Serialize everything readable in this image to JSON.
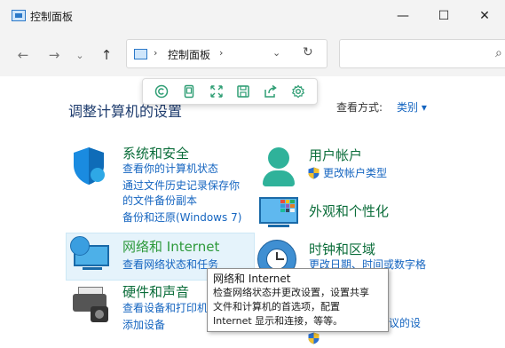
{
  "window": {
    "title": "控制面板",
    "minimize_glyph": "—",
    "maximize_glyph": "☐",
    "close_glyph": "✕"
  },
  "nav": {
    "back_glyph": "←",
    "forward_glyph": "→",
    "recent_glyph": "⌄",
    "up_glyph": "↑",
    "address": {
      "separator": "›",
      "path": "控制面板",
      "dropdown_glyph": "⌄",
      "refresh_glyph": "↻"
    },
    "search": {
      "icon_glyph": "⌕"
    }
  },
  "floating_toolbar": {
    "icons": [
      "copyright-circle-icon",
      "tablet-icon",
      "expand-icon",
      "save-icon",
      "share-icon",
      "settings-icon"
    ]
  },
  "header": {
    "heading": "调整计算机的设置",
    "view_label": "查看方式:",
    "view_value": "类别 ▾"
  },
  "categories": {
    "system_security": {
      "title": "系统和安全",
      "links": [
        "查看你的计算机状态",
        "通过文件历史记录保存你",
        "的文件备份副本",
        "备份和还原(Windows 7)"
      ]
    },
    "network": {
      "title": "网络和 Internet",
      "links": [
        "查看网络状态和任务"
      ]
    },
    "hardware": {
      "title": "硬件和声音",
      "links": [
        "查看设备和打印机",
        "添加设备"
      ]
    },
    "user_accounts": {
      "title": "用户帐户",
      "links": [
        "更改帐户类型"
      ]
    },
    "appearance": {
      "title": "外观和个性化"
    },
    "clock_region": {
      "title": "时钟和区域",
      "links": [
        "更改日期、时间或数字格",
        "议的设"
      ]
    }
  },
  "tooltip": {
    "title": "网络和 Internet",
    "body": "检查网络状态并更改设置，设置共享\n文件和计算机的首选项，配置\nInternet 显示和连接，等等。"
  },
  "colors": {
    "link": "#1565c0",
    "category_title": "#0b6d3a",
    "heading": "#1e3c6e",
    "toolbar_accent": "#2f9e74"
  }
}
